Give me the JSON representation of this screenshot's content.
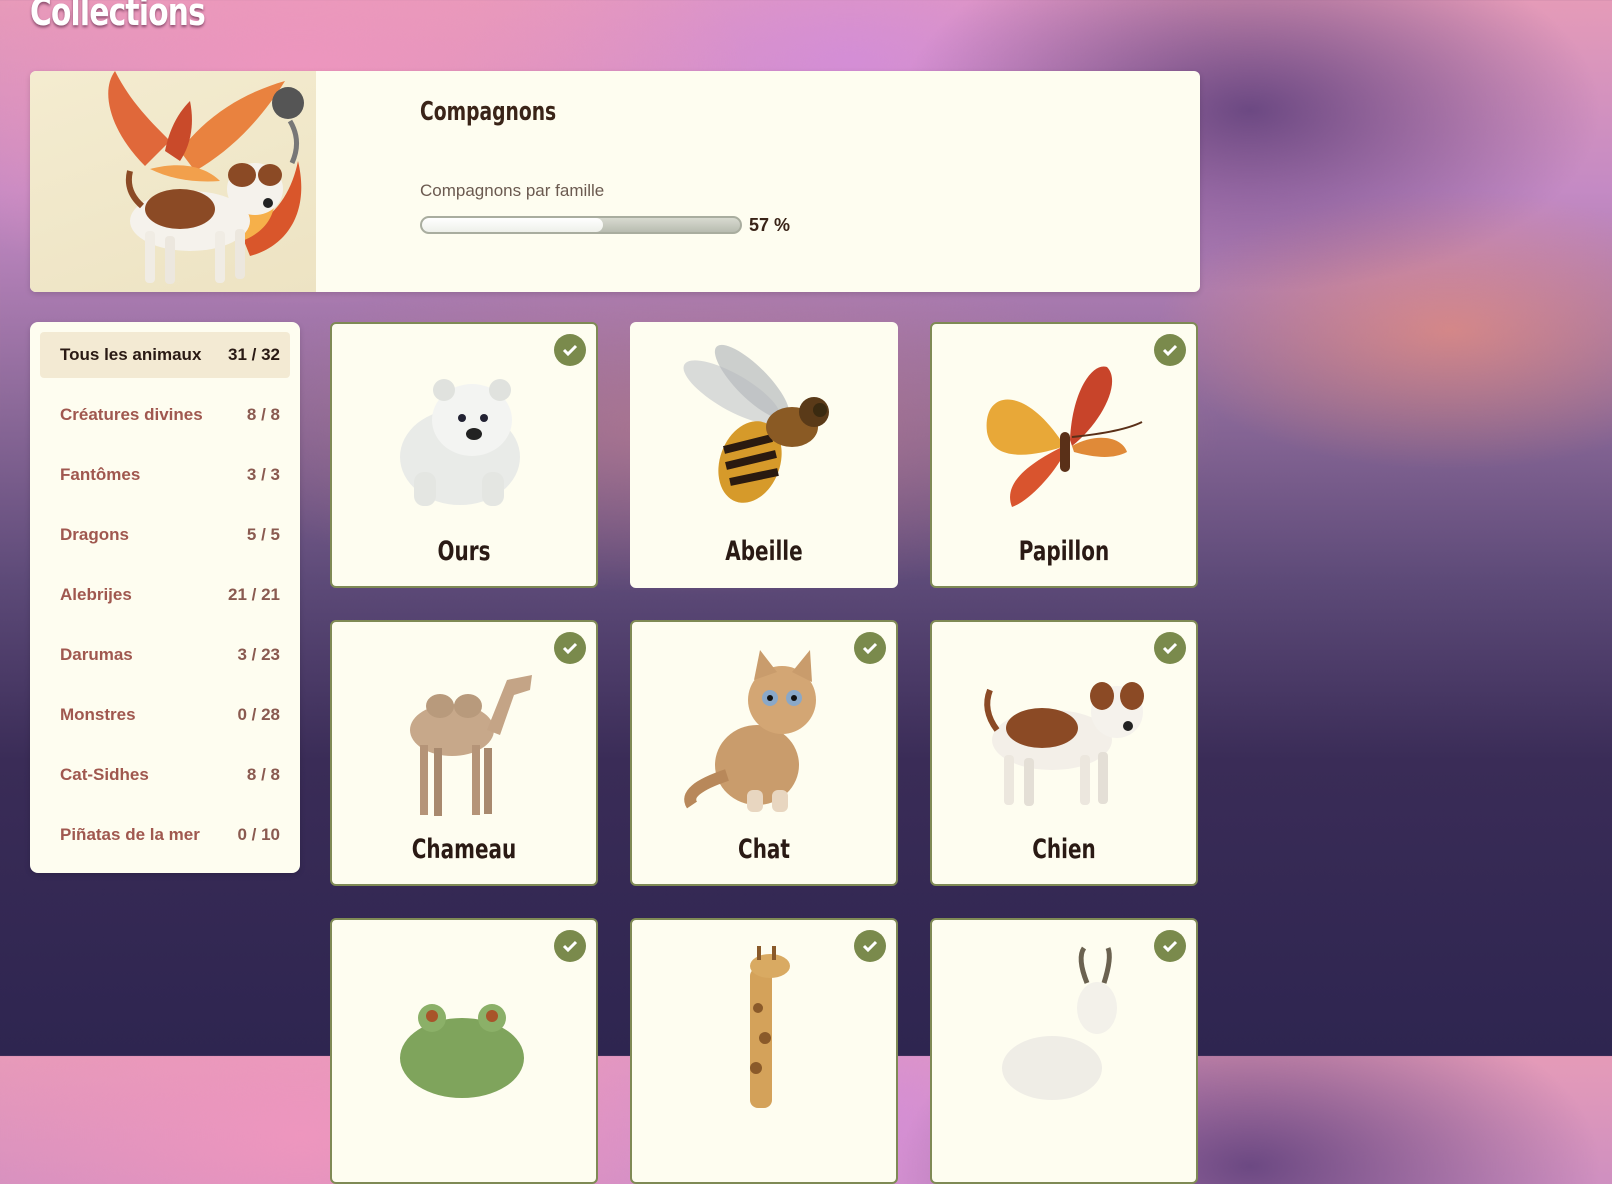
{
  "page": {
    "title": "Collections"
  },
  "header": {
    "title": "Compagnons",
    "progress_label": "Compagnons par famille",
    "progress_percent": 57,
    "progress_text": "57 %"
  },
  "sidebar": {
    "items": [
      {
        "label": "Tous les animaux",
        "count": "31 / 32",
        "active": true
      },
      {
        "label": "Créatures divines",
        "count": "8 / 8"
      },
      {
        "label": "Fantômes",
        "count": "3 / 3"
      },
      {
        "label": "Dragons",
        "count": "5 / 5"
      },
      {
        "label": "Alebrijes",
        "count": "21 / 21"
      },
      {
        "label": "Darumas",
        "count": "3 / 23"
      },
      {
        "label": "Monstres",
        "count": "0 / 28"
      },
      {
        "label": "Cat-Sidhes",
        "count": "8 / 8"
      },
      {
        "label": "Piñatas de la mer",
        "count": "0 / 10"
      }
    ]
  },
  "cards": [
    {
      "name": "Ours",
      "owned": true,
      "icon": "polar-bear-icon"
    },
    {
      "name": "Abeille",
      "owned": false,
      "icon": "bee-icon"
    },
    {
      "name": "Papillon",
      "owned": true,
      "icon": "butterfly-icon"
    },
    {
      "name": "Chameau",
      "owned": true,
      "icon": "camel-icon"
    },
    {
      "name": "Chat",
      "owned": true,
      "icon": "cat-icon"
    },
    {
      "name": "Chien",
      "owned": true,
      "icon": "dog-icon"
    },
    {
      "name": "",
      "owned": true,
      "icon": "frog-icon"
    },
    {
      "name": "",
      "owned": true,
      "icon": "giraffe-icon"
    },
    {
      "name": "",
      "owned": true,
      "icon": "goat-icon"
    }
  ],
  "colors": {
    "owned_border": "#7f8a55",
    "check_badge": "#7a8a4c",
    "inactive_label": "#a0584f",
    "panel_bg": "#fefdf0"
  }
}
